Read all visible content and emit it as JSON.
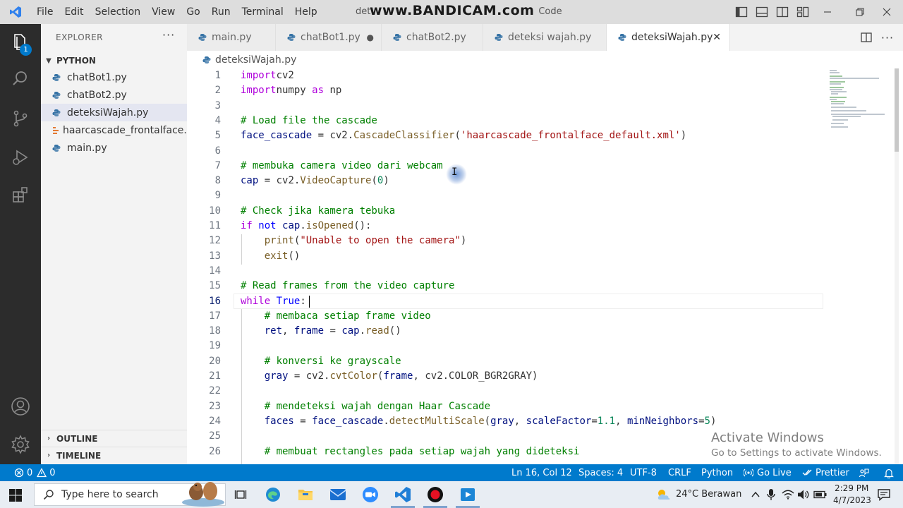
{
  "titlebar": {
    "menu": [
      "File",
      "Edit",
      "Selection",
      "View",
      "Go",
      "Run",
      "Terminal",
      "Help"
    ],
    "window_title_fragment_left": "det",
    "window_title_fragment_right": "Code",
    "watermark": "www.BANDICAM.com"
  },
  "activity_bar": {
    "badge": "1",
    "icons": [
      "explorer-icon",
      "search-icon",
      "source-control-icon",
      "run-debug-icon",
      "extensions-icon",
      "account-icon",
      "settings-gear-icon"
    ]
  },
  "sidebar": {
    "title": "EXPLORER",
    "more": "···",
    "folder": "PYTHON",
    "files": [
      {
        "name": "chatBot1.py",
        "icon": "python-icon"
      },
      {
        "name": "chatBot2.py",
        "icon": "python-icon"
      },
      {
        "name": "deteksiWajah.py",
        "icon": "python-icon",
        "active": true
      },
      {
        "name": "haarcascade_frontalface...",
        "icon": "xml-icon"
      },
      {
        "name": "main.py",
        "icon": "python-icon"
      }
    ],
    "outline": "OUTLINE",
    "timeline": "TIMELINE"
  },
  "tabs": [
    {
      "label": "main.py",
      "state": "normal"
    },
    {
      "label": "chatBot1.py",
      "state": "modified",
      "marker": "●"
    },
    {
      "label": "chatBot2.py",
      "state": "normal"
    },
    {
      "label": "deteksi wajah.py",
      "state": "normal"
    },
    {
      "label": "deteksiWajah.py",
      "state": "active",
      "marker": "✕"
    }
  ],
  "breadcrumb": "deteksiWajah.py",
  "code_lines": [
    {
      "n": "1",
      "segs": [
        [
          "kw2",
          "import"
        ],
        [
          "",
          "cv2"
        ]
      ]
    },
    {
      "n": "2",
      "segs": [
        [
          "kw2",
          "import"
        ],
        [
          "",
          "numpy "
        ],
        [
          "kw2",
          "as"
        ],
        [
          "",
          " np"
        ]
      ]
    },
    {
      "n": "3",
      "segs": []
    },
    {
      "n": "4",
      "segs": [
        [
          "com",
          "# Load file the cascade"
        ]
      ]
    },
    {
      "n": "5",
      "segs": [
        [
          "var",
          "face_cascade"
        ],
        [
          "",
          " = cv2."
        ],
        [
          "fn",
          "CascadeClassifier"
        ],
        [
          "",
          "("
        ],
        [
          "str",
          "'haarcascade_frontalface_default.xml'"
        ],
        [
          "",
          ")"
        ]
      ]
    },
    {
      "n": "6",
      "segs": []
    },
    {
      "n": "7",
      "segs": [
        [
          "com",
          "# membuka camera video dari webcam"
        ]
      ]
    },
    {
      "n": "8",
      "segs": [
        [
          "var",
          "cap"
        ],
        [
          "",
          " = cv2."
        ],
        [
          "fn",
          "VideoCapture"
        ],
        [
          "",
          "("
        ],
        [
          "num",
          "0"
        ],
        [
          "",
          ")"
        ]
      ]
    },
    {
      "n": "9",
      "segs": []
    },
    {
      "n": "10",
      "segs": [
        [
          "com",
          "# Check jika kamera tebuka"
        ]
      ]
    },
    {
      "n": "11",
      "segs": [
        [
          "kw2",
          "if"
        ],
        [
          "",
          " "
        ],
        [
          "kw",
          "not"
        ],
        [
          "",
          " "
        ],
        [
          "var",
          "cap"
        ],
        [
          "",
          "."
        ],
        [
          "fn",
          "isOpened"
        ],
        [
          "",
          "():"
        ]
      ]
    },
    {
      "n": "12",
      "segs": [
        [
          "",
          "    "
        ],
        [
          "fn",
          "print"
        ],
        [
          "",
          "("
        ],
        [
          "str",
          "\"Unable to open the camera\""
        ],
        [
          "",
          ")"
        ]
      ]
    },
    {
      "n": "13",
      "segs": [
        [
          "",
          "    "
        ],
        [
          "fn",
          "exit"
        ],
        [
          "",
          "()"
        ]
      ]
    },
    {
      "n": "14",
      "segs": []
    },
    {
      "n": "15",
      "segs": [
        [
          "com",
          "# Read frames from the video capture"
        ]
      ]
    },
    {
      "n": "16",
      "segs": [
        [
          "kw2",
          "while"
        ],
        [
          "",
          " "
        ],
        [
          "kw",
          "True"
        ],
        [
          "",
          ":"
        ]
      ],
      "current": true
    },
    {
      "n": "17",
      "segs": [
        [
          "",
          "    "
        ],
        [
          "com",
          "# membaca setiap frame video"
        ]
      ]
    },
    {
      "n": "18",
      "segs": [
        [
          "",
          "    "
        ],
        [
          "var",
          "ret"
        ],
        [
          "",
          ", "
        ],
        [
          "var",
          "frame"
        ],
        [
          "",
          " = "
        ],
        [
          "var",
          "cap"
        ],
        [
          "",
          "."
        ],
        [
          "fn",
          "read"
        ],
        [
          "",
          "()"
        ]
      ]
    },
    {
      "n": "19",
      "segs": []
    },
    {
      "n": "20",
      "segs": [
        [
          "",
          "    "
        ],
        [
          "com",
          "# konversi ke grayscale"
        ]
      ]
    },
    {
      "n": "21",
      "segs": [
        [
          "",
          "    "
        ],
        [
          "var",
          "gray"
        ],
        [
          "",
          " = cv2."
        ],
        [
          "fn",
          "cvtColor"
        ],
        [
          "",
          "("
        ],
        [
          "var",
          "frame"
        ],
        [
          "",
          ", cv2.COLOR_BGR2GRAY)"
        ]
      ]
    },
    {
      "n": "22",
      "segs": []
    },
    {
      "n": "23",
      "segs": [
        [
          "",
          "    "
        ],
        [
          "com",
          "# mendeteksi wajah dengan Haar Cascade"
        ]
      ]
    },
    {
      "n": "24",
      "segs": [
        [
          "",
          "    "
        ],
        [
          "var",
          "faces"
        ],
        [
          "",
          " = "
        ],
        [
          "var",
          "face_cascade"
        ],
        [
          "",
          "."
        ],
        [
          "fn",
          "detectMultiScale"
        ],
        [
          "",
          "("
        ],
        [
          "var",
          "gray"
        ],
        [
          "",
          ", "
        ],
        [
          "param",
          "scaleFactor"
        ],
        [
          "",
          "="
        ],
        [
          "num",
          "1.1"
        ],
        [
          "",
          ", "
        ],
        [
          "param",
          "minNeighbors"
        ],
        [
          "",
          "="
        ],
        [
          "num",
          "5"
        ],
        [
          "",
          ")"
        ]
      ]
    },
    {
      "n": "25",
      "segs": []
    },
    {
      "n": "26",
      "segs": [
        [
          "",
          "    "
        ],
        [
          "com",
          "# membuat rectangles pada setiap wajah yang dideteksi"
        ]
      ]
    }
  ],
  "watermark_windows": {
    "title": "Activate Windows",
    "subtitle": "Go to Settings to activate Windows."
  },
  "statusbar": {
    "errors": "0",
    "warnings": "0",
    "position": "Ln 16, Col 12",
    "spaces": "Spaces: 4",
    "encoding": "UTF-8",
    "eol": "CRLF",
    "language": "Python",
    "go_live": "Go Live",
    "prettier": "Prettier"
  },
  "taskbar": {
    "search_placeholder": "Type here to search",
    "weather": "24°C  Berawan",
    "time": "2:29 PM",
    "date": "4/7/2023",
    "colors": {
      "accent": "#007acc",
      "python": "#3572a5",
      "record": "#e81123"
    }
  }
}
